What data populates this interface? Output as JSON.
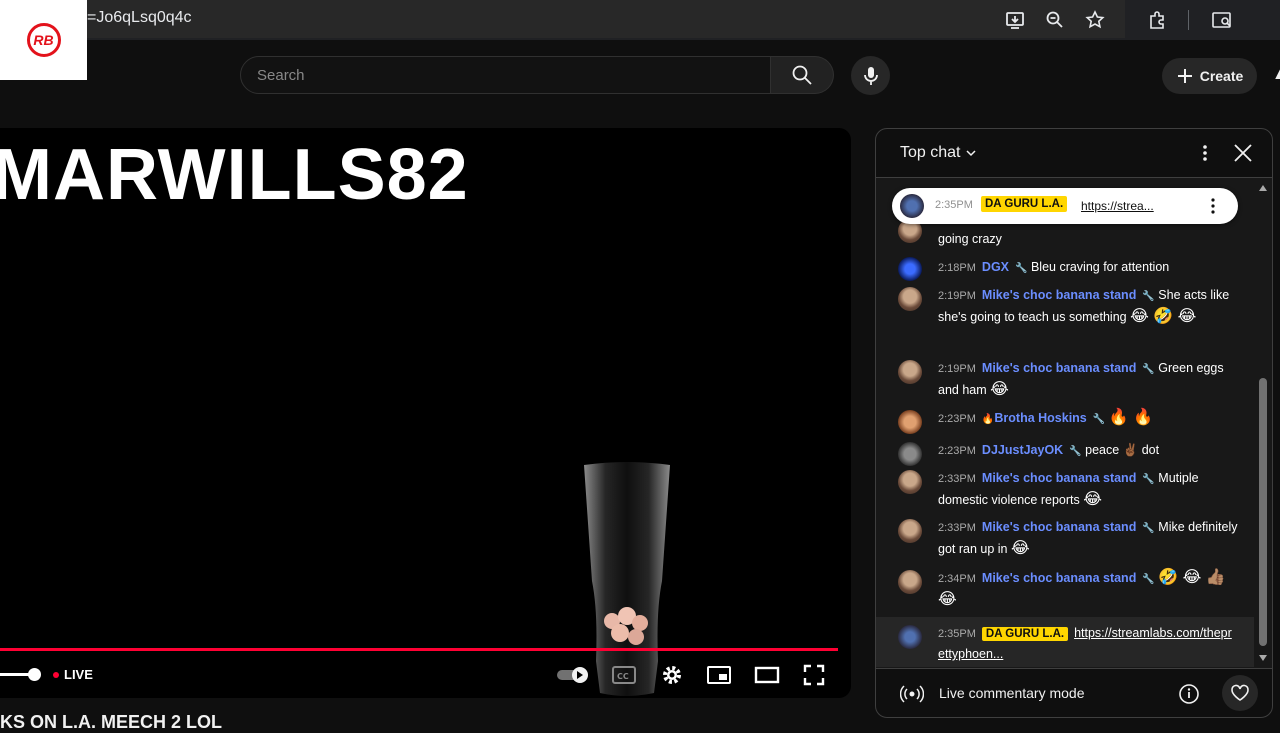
{
  "browser": {
    "url_fragment": "=Jo6qLsq0q4c",
    "logo_text": "RB"
  },
  "header": {
    "search_placeholder": "Search",
    "create_label": "Create"
  },
  "video": {
    "overlay_title": "MARWILLS82",
    "live_label": "LIVE",
    "below_title": "KS ON L.A. MEECH 2 LOL"
  },
  "chat": {
    "header_title": "Top chat",
    "pinned": {
      "time": "2:35PM",
      "author": "DA GURU L.A.",
      "text": "https://strea..."
    },
    "messages": [
      {
        "time": "",
        "author": "",
        "text": "going crazy",
        "emoji": ""
      },
      {
        "time": "2:18PM",
        "author": "DGX",
        "text": "Bleu craving for attention",
        "emoji": ""
      },
      {
        "time": "2:19PM",
        "author": "Mike's choc banana stand",
        "text": "She acts like she's going to teach us something",
        "emoji": "😂 🤣 😂"
      },
      {
        "time": "2:19PM",
        "author": "Mike's choc banana stand",
        "text": "Green eggs and ham",
        "emoji": "😂"
      },
      {
        "time": "2:23PM",
        "author": "Brotha Hoskins",
        "text": "",
        "emoji": "🔥 🔥"
      },
      {
        "time": "2:23PM",
        "author": "DJJustJayOK",
        "text": "peace ✌🏾 dot",
        "emoji": ""
      },
      {
        "time": "2:33PM",
        "author": "Mike's choc banana stand",
        "text": "Mutiple domestic violence reports",
        "emoji": "😂"
      },
      {
        "time": "2:33PM",
        "author": "Mike's choc banana stand",
        "text": "Mike definitely got ran up in",
        "emoji": "😂"
      },
      {
        "time": "2:34PM",
        "author": "Mike's choc banana stand",
        "text": "",
        "emoji": "🤣 😂 👍🏽 😂"
      },
      {
        "time": "2:35PM",
        "author": "DA GURU L.A.",
        "text": "https://streamlabs.com/theprettyphoen...",
        "emoji": ""
      }
    ],
    "footer_mode": "Live commentary mode"
  }
}
